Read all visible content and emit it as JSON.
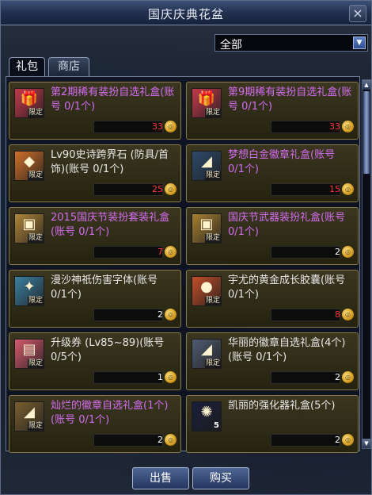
{
  "window": {
    "title": "国庆庆典花盆"
  },
  "filter": {
    "value": "全部"
  },
  "tabs": [
    {
      "label": "礼包"
    },
    {
      "label": "商店"
    }
  ],
  "items": [
    {
      "name": "第2期稀有装扮自选礼盒(账号 0/1个)",
      "price": "33",
      "color": "purple",
      "icon_glyph": "🎁",
      "icon_bg": "#c2394d",
      "tag": "限定",
      "price_color": "red"
    },
    {
      "name": "第9期稀有装扮自选礼盒(账号 0/1个)",
      "price": "33",
      "color": "purple",
      "icon_glyph": "🎁",
      "icon_bg": "#c2394d",
      "tag": "限定",
      "price_color": "red"
    },
    {
      "name": "Lv90史诗跨界石 (防具/首饰)(账号 0/1个)",
      "price": "25",
      "color": "white",
      "icon_glyph": "◆",
      "icon_bg": "#d0702a",
      "tag": "限定",
      "price_color": "red"
    },
    {
      "name": "梦想白金徽章礼盒(账号 0/1个)",
      "price": "15",
      "color": "purple",
      "icon_glyph": "◢",
      "icon_bg": "#2d4b6a",
      "tag": "限定",
      "price_color": "red"
    },
    {
      "name": "2015国庆节装扮套装礼盒(账号 0/1个)",
      "price": "7",
      "color": "purple",
      "icon_glyph": "▣",
      "icon_bg": "#b0863a",
      "tag": "限定",
      "price_color": "red"
    },
    {
      "name": "国庆节武器装扮礼盒(账号 0/1个)",
      "price": "2",
      "color": "purple",
      "icon_glyph": "▣",
      "icon_bg": "#a88032",
      "tag": "限定",
      "price_color": "white"
    },
    {
      "name": "漫沙神祇伤害字体(账号 0/1个)",
      "price": "2",
      "color": "white",
      "icon_glyph": "✦",
      "icon_bg": "#3d7fa0",
      "tag": "限定",
      "price_color": "white"
    },
    {
      "name": "宇尤的黄金成长胶囊(账号 0/1个)",
      "price": "8",
      "color": "white",
      "icon_glyph": "●",
      "icon_bg": "#c24f2a",
      "tag": "限定",
      "price_color": "red"
    },
    {
      "name": "升级券 (Lv85~89)(账号 0/5个)",
      "price": "1",
      "color": "white",
      "icon_glyph": "▤",
      "icon_bg": "#d75a6f",
      "tag": "限定",
      "price_color": "white"
    },
    {
      "name": "华丽的徽章自选礼盒(4个)(账号 0/1个)",
      "price": "2",
      "color": "white",
      "icon_glyph": "◢",
      "icon_bg": "#4f5c70",
      "tag": "限定",
      "price_color": "white"
    },
    {
      "name": "灿烂的徽章自选礼盒(1个)(账号 0/1个)",
      "price": "2",
      "color": "purple",
      "icon_glyph": "◢",
      "icon_bg": "#7a6030",
      "tag": "限定",
      "price_color": "white"
    },
    {
      "name": "凯丽的强化器礼盒(5个)",
      "price": "2",
      "color": "white",
      "icon_glyph": "✺",
      "icon_bg": "#1a1f3a",
      "num": "5",
      "price_color": "white"
    }
  ],
  "buttons": {
    "sell": "出售",
    "buy": "购买"
  },
  "coin_glyph": "◎"
}
